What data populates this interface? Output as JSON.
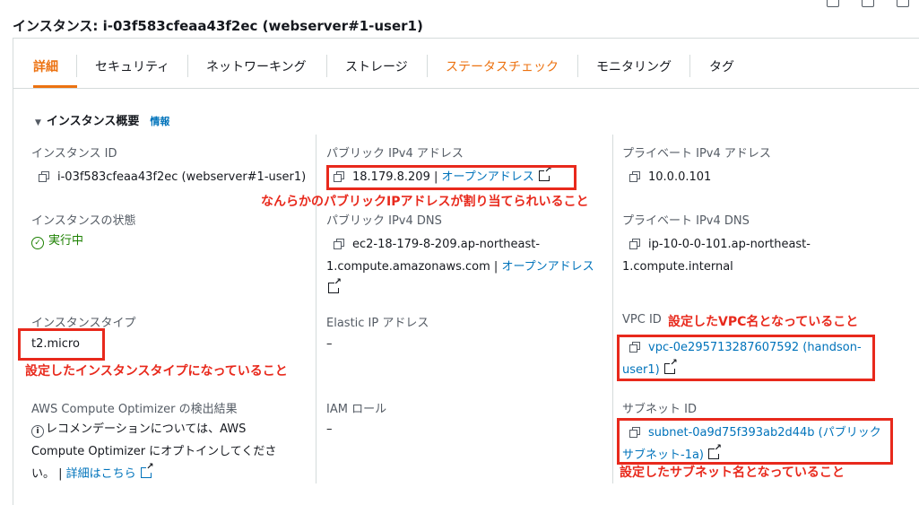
{
  "header": {
    "title": "インスタンス: i-03f583cfeaa43f2ec (webserver#1-user1)"
  },
  "tabs": [
    {
      "label": "詳細"
    },
    {
      "label": "セキュリティ"
    },
    {
      "label": "ネットワーキング"
    },
    {
      "label": "ストレージ"
    },
    {
      "label": "ステータスチェック"
    },
    {
      "label": "モニタリング"
    },
    {
      "label": "タグ"
    }
  ],
  "section": {
    "title": "インスタンス概要",
    "info": "情報"
  },
  "fields": {
    "instance_id_label": "インスタンス ID",
    "instance_id": "i-03f583cfeaa43f2ec (webserver#1-user1)",
    "public_ip_label": "パブリック IPv4 アドレス",
    "public_ip": "18.179.8.209",
    "public_ip_sep": " | ",
    "open_address": "オープンアドレス",
    "private_ip_label": "プライベート IPv4 アドレス",
    "private_ip": "10.0.0.101",
    "state_label": "インスタンスの状態",
    "state": "実行中",
    "public_dns_label": "パブリック IPv4 DNS",
    "public_dns_line1": "ec2-18-179-8-209.ap-northeast-",
    "public_dns_line2": "1.compute.amazonaws.com",
    "private_dns_label": "プライベート IPv4 DNS",
    "private_dns_line1": "ip-10-0-0-101.ap-northeast-",
    "private_dns_line2": "1.compute.internal",
    "type_label": "インスタンスタイプ",
    "type": "t2.micro",
    "eip_label": "Elastic IP アドレス",
    "eip": "–",
    "vpc_label": "VPC ID",
    "vpc_line1": "vpc-0e295713287607592 (handson-",
    "vpc_line2": "user1)",
    "optimizer_label": "AWS Compute Optimizer の検出結果",
    "optimizer_line1": "レコメンデーションについては、AWS",
    "optimizer_line2": "Compute Optimizer にオプトインしてくださ",
    "optimizer_line3": "い。 | ",
    "optimizer_link": "詳細はこちら",
    "iam_label": "IAM ロール",
    "iam": "–",
    "subnet_label": "サブネット ID",
    "subnet_line1": "subnet-0a9d75f393ab2d44b (パブリック",
    "subnet_line2": "サブネット-1a)"
  },
  "annotations": {
    "public_ip": "なんらかのパブリックIPアドレスが割り当てられいること",
    "instance_type": "設定したインスタンスタイプになっていること",
    "vpc": "設定したVPC名となっていること",
    "subnet": "設定したサブネット名となっていること"
  },
  "colors": {
    "accent": "#ec7211",
    "link": "#0073bb",
    "running": "#1d8102",
    "annotation": "#e8291c"
  }
}
